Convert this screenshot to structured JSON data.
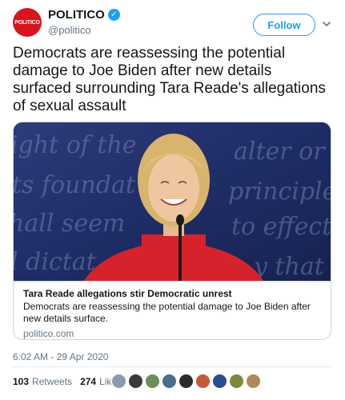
{
  "author": {
    "avatar_text": "POLITICO",
    "display_name": "POLITICO",
    "handle": "@politico",
    "verified_icon": "verified-badge-icon",
    "avatar_color": "#d8151f"
  },
  "follow_button": {
    "label": "Follow"
  },
  "menu": {
    "icon": "chevron-down-icon"
  },
  "tweet": {
    "text": "Democrats are reassessing the potential damage to Joe Biden after new details surfaced surrounding Tara Reade's allegations of sexual assault"
  },
  "card": {
    "title": "Tara Reade allegations stir Democratic unrest",
    "description": "Democrats are reassessing the potential damage to Joe Biden after new details surface.",
    "domain": "politico.com"
  },
  "timestamp": "6:02 AM - 29 Apr 2020",
  "stats": {
    "retweets_count": "103",
    "retweets_label": "Retweets",
    "likes_count": "274",
    "likes_label": "Likes"
  },
  "likers": [
    {
      "name": "liker-avatar-1",
      "color": "#8a9bb0"
    },
    {
      "name": "liker-avatar-2",
      "color": "#3a3a3a"
    },
    {
      "name": "liker-avatar-3",
      "color": "#6b8f5a"
    },
    {
      "name": "liker-avatar-4",
      "color": "#4a6e8c"
    },
    {
      "name": "liker-avatar-5",
      "color": "#2b2b2b"
    },
    {
      "name": "liker-avatar-6",
      "color": "#c25a3a"
    },
    {
      "name": "liker-avatar-7",
      "color": "#2a4d8f"
    },
    {
      "name": "liker-avatar-8",
      "color": "#7a8a3c"
    },
    {
      "name": "liker-avatar-9",
      "color": "#b08a5a"
    }
  ],
  "colors": {
    "accent": "#1da1f2",
    "text": "#14171a",
    "muted": "#657786",
    "border": "#ccd6dd"
  }
}
